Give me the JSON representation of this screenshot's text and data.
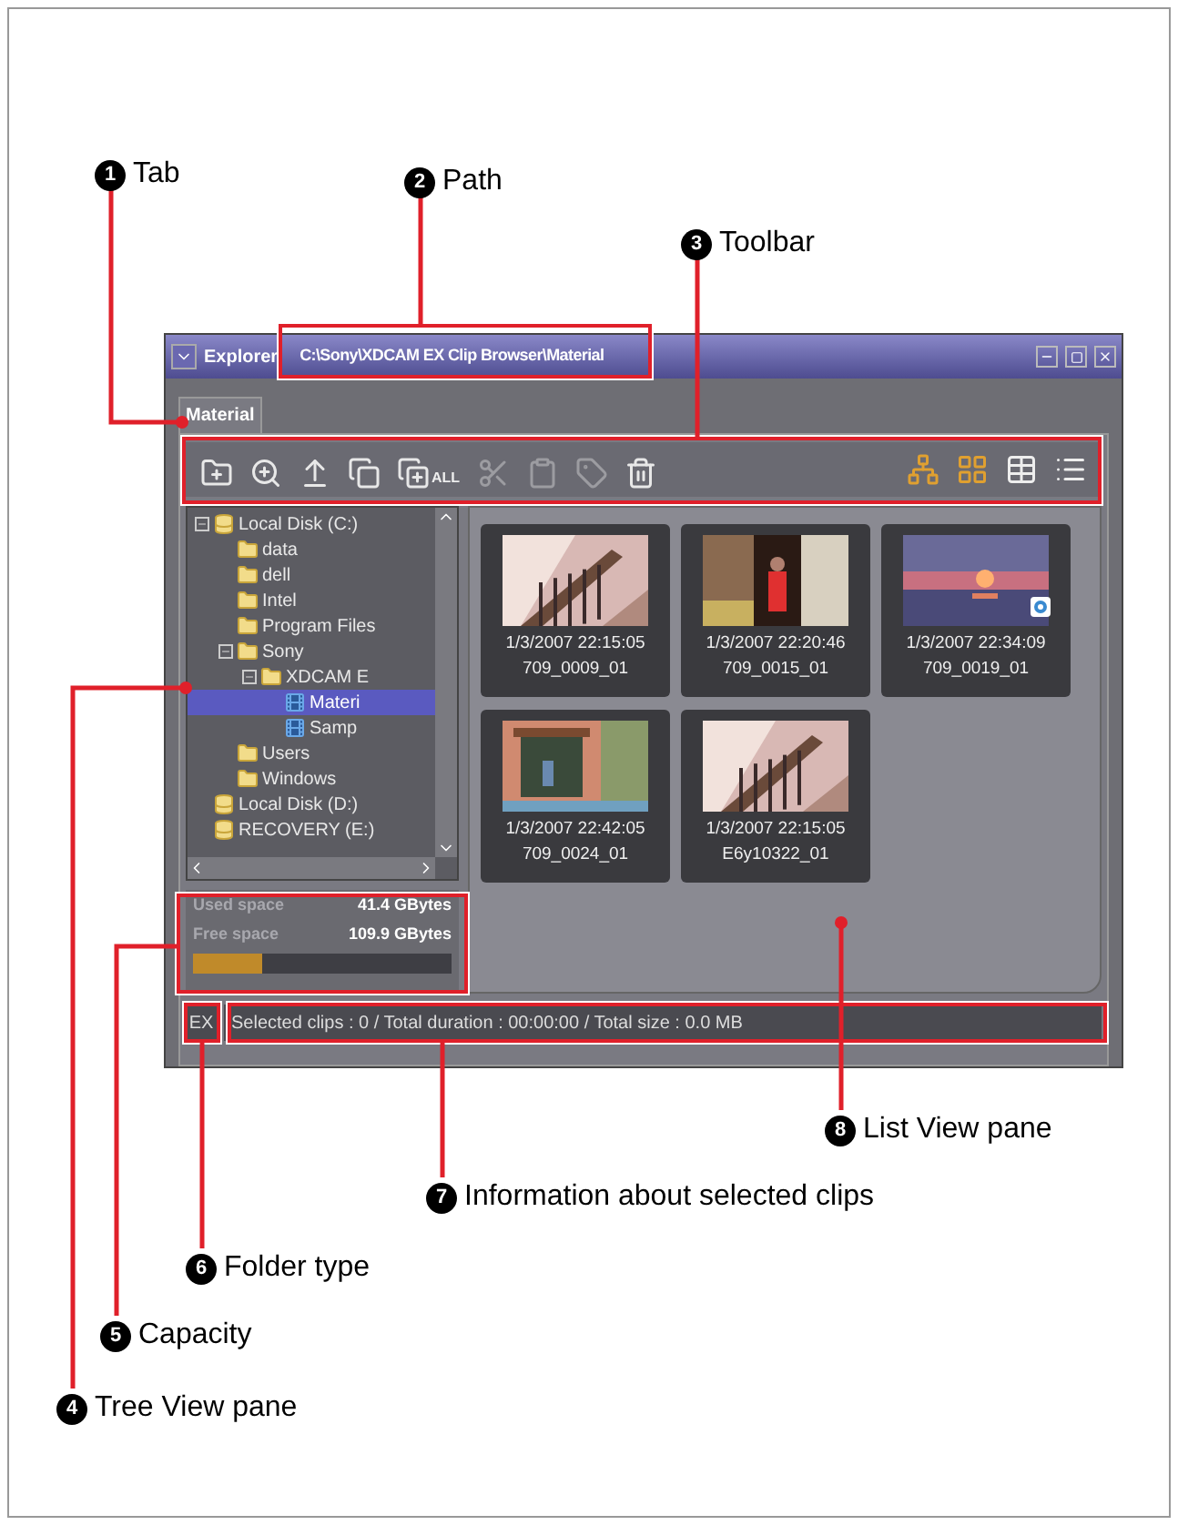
{
  "callouts": [
    {
      "number": "1",
      "label": "Tab"
    },
    {
      "number": "2",
      "label": "Path"
    },
    {
      "number": "3",
      "label": "Toolbar"
    },
    {
      "number": "8",
      "label": "List View pane"
    },
    {
      "number": "7",
      "label": "Information about selected clips"
    },
    {
      "number": "6",
      "label": "Folder type"
    },
    {
      "number": "5",
      "label": "Capacity"
    },
    {
      "number": "4",
      "label": "Tree View pane"
    }
  ],
  "window": {
    "title": "Explorer",
    "path": "C:\\Sony\\XDCAM EX Clip Browser\\Material"
  },
  "tabs": [
    {
      "label": "Material",
      "selected": true
    }
  ],
  "toolbar": {
    "actions": [
      {
        "disabled": false
      },
      {
        "disabled": false
      },
      {
        "disabled": false
      },
      {
        "disabled": false
      },
      {
        "disabled": false,
        "label": "ALL"
      },
      {
        "disabled": true
      },
      {
        "disabled": true
      },
      {
        "disabled": true
      },
      {
        "disabled": false
      }
    ],
    "views": [
      {
        "selected": true
      },
      {
        "selected": true
      },
      {
        "selected": false
      },
      {
        "selected": false
      }
    ]
  },
  "tree": [
    {
      "kind": "drive",
      "label": "Local Disk (C:)",
      "expanded": true,
      "selected": false,
      "children": [
        {
          "kind": "folder",
          "label": "data",
          "selected": false
        },
        {
          "kind": "folder",
          "label": "dell",
          "selected": false
        },
        {
          "kind": "folder",
          "label": "Intel",
          "selected": false
        },
        {
          "kind": "folder",
          "label": "Program Files",
          "selected": false
        },
        {
          "kind": "folder",
          "label": "Sony",
          "expanded": true,
          "selected": false,
          "children": [
            {
              "kind": "folder",
              "label": "XDCAM E",
              "expanded": true,
              "selected": false,
              "children": [
                {
                  "kind": "clips",
                  "label": "Materi",
                  "selected": true
                },
                {
                  "kind": "clips",
                  "label": "Samp",
                  "selected": false
                }
              ]
            }
          ]
        },
        {
          "kind": "folder",
          "label": "Users",
          "selected": false
        },
        {
          "kind": "folder",
          "label": "Windows",
          "selected": false
        }
      ]
    },
    {
      "kind": "drive",
      "label": "Local Disk (D:)",
      "selected": false
    },
    {
      "kind": "drive",
      "label": "RECOVERY (E:)",
      "selected": false
    }
  ],
  "capacity": {
    "used_label": "Used space",
    "used": "41.4 GBytes",
    "free_label": "Free space",
    "free": "109.9 GBytes",
    "level": 0.27
  },
  "clips": [
    {
      "date": "1/3/2007 22:15:05",
      "name": "709_0009_01",
      "badge": false
    },
    {
      "date": "1/3/2007 22:20:46",
      "name": "709_0015_01",
      "badge": false
    },
    {
      "date": "1/3/2007 22:34:09",
      "name": "709_0019_01",
      "badge": true
    },
    {
      "date": "1/3/2007 22:42:05",
      "name": "709_0024_01",
      "badge": false
    },
    {
      "date": "1/3/2007 22:15:05",
      "name": "E6y10322_01",
      "badge": false
    }
  ],
  "status_bar": {
    "folder_type": "EX",
    "info": "Selected clips : 0 / Total duration : 00:00:00 / Total size : 0.0 MB"
  }
}
